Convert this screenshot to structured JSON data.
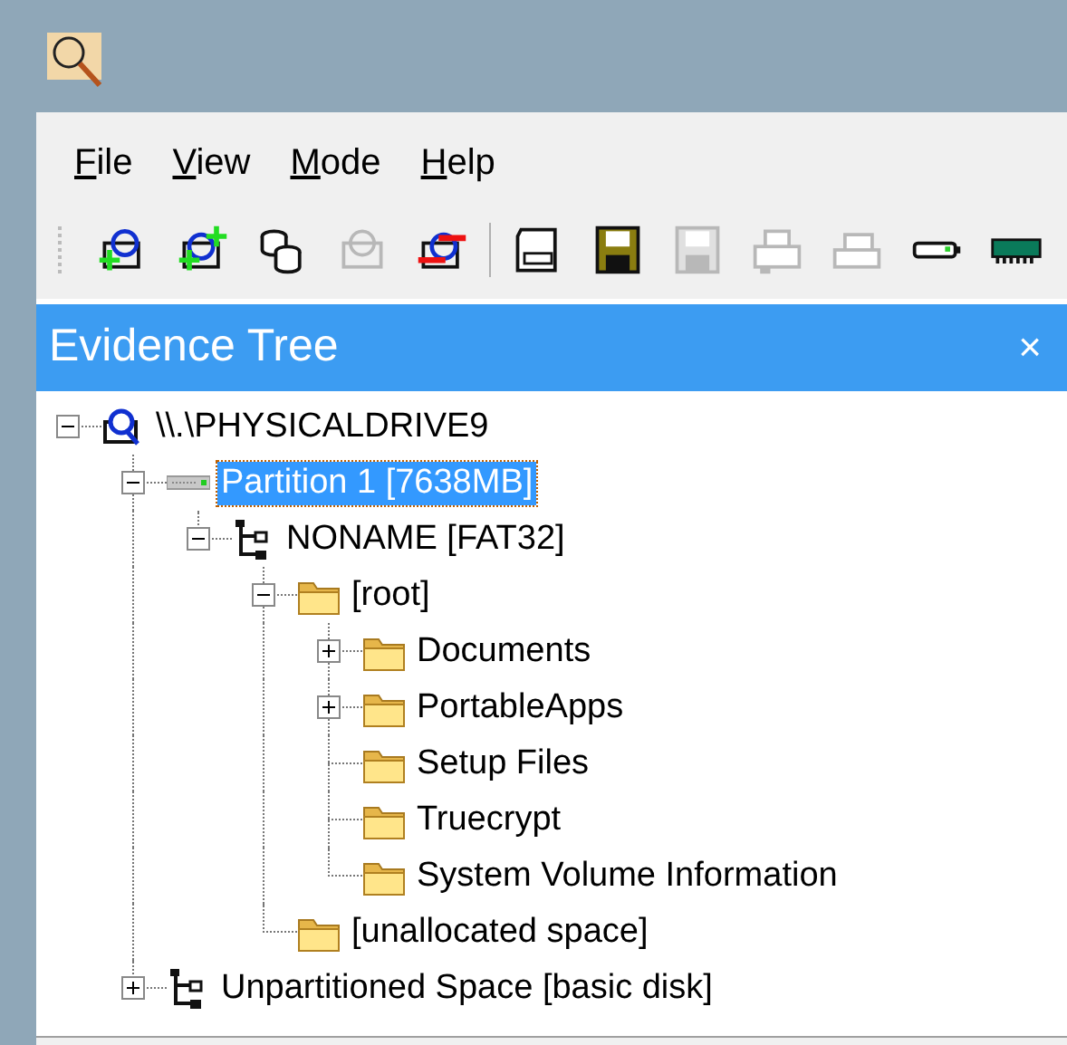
{
  "menu": [
    {
      "label": "File"
    },
    {
      "label": "View"
    },
    {
      "label": "Mode"
    },
    {
      "label": "Help"
    }
  ],
  "toolbar": [
    {
      "kind": "add-image",
      "disabled": false
    },
    {
      "kind": "add-folder",
      "disabled": false
    },
    {
      "kind": "databases",
      "disabled": false
    },
    {
      "kind": "open-image",
      "disabled": true
    },
    {
      "kind": "remove-image",
      "disabled": false
    },
    {
      "kind": "separator"
    },
    {
      "kind": "drive",
      "disabled": false
    },
    {
      "kind": "floppy",
      "disabled": false
    },
    {
      "kind": "floppy",
      "disabled": true
    },
    {
      "kind": "printer",
      "disabled": true
    },
    {
      "kind": "scanner",
      "disabled": true
    },
    {
      "kind": "usb",
      "disabled": false
    },
    {
      "kind": "memory",
      "disabled": false
    }
  ],
  "panel": {
    "title": "Evidence Tree",
    "close": "×"
  },
  "tree": [
    {
      "label": "\\\\.\\PHYSICALDRIVE9",
      "kind": "disk",
      "expanded": true,
      "selected": false,
      "children": [
        {
          "label": "Partition 1 [7638MB]",
          "kind": "partition",
          "expanded": true,
          "selected": true,
          "children": [
            {
              "label": "NONAME [FAT32]",
              "kind": "filesystem",
              "expanded": true,
              "selected": false,
              "children": [
                {
                  "label": "[root]",
                  "kind": "folder",
                  "expanded": true,
                  "selected": false,
                  "children": [
                    {
                      "label": "Documents",
                      "kind": "folder",
                      "expanded": false,
                      "selected": false
                    },
                    {
                      "label": "PortableApps",
                      "kind": "folder",
                      "expanded": false,
                      "selected": false
                    },
                    {
                      "label": "Setup Files",
                      "kind": "folder",
                      "selected": false
                    },
                    {
                      "label": "Truecrypt",
                      "kind": "folder",
                      "selected": false
                    },
                    {
                      "label": "System Volume Information",
                      "kind": "folder",
                      "selected": false
                    }
                  ]
                },
                {
                  "label": "[unallocated space]",
                  "kind": "folder",
                  "selected": false
                }
              ]
            }
          ]
        },
        {
          "label": "Unpartitioned Space [basic disk]",
          "kind": "filesystem",
          "expanded": false,
          "selected": false
        }
      ]
    }
  ]
}
